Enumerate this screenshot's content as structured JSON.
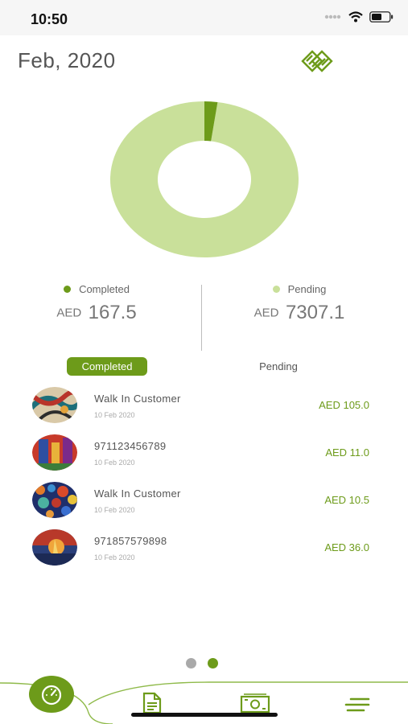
{
  "status_bar": {
    "time": "10:50"
  },
  "header": {
    "month": "Feb, 2020"
  },
  "donut": {
    "completed": 167.5,
    "pending": 7307.1,
    "completed_color": "#6d9b1a",
    "pending_color": "#c9e09a"
  },
  "summary": {
    "completed": {
      "label": "Completed",
      "currency": "AED",
      "amount": "167.5",
      "color": "#6d9b1a"
    },
    "pending": {
      "label": "Pending",
      "currency": "AED",
      "amount": "7307.1",
      "color": "#c9e09a"
    }
  },
  "tabs": {
    "completed": "Completed",
    "pending": "Pending",
    "active": "completed"
  },
  "transactions": [
    {
      "customer": "Walk In Customer",
      "date": "10 Feb 2020",
      "amount": "AED 105.0"
    },
    {
      "customer": "971123456789",
      "date": "10 Feb 2020",
      "amount": "AED 11.0"
    },
    {
      "customer": "Walk In Customer",
      "date": "10 Feb 2020",
      "amount": "AED 10.5"
    },
    {
      "customer": "971857579898",
      "date": "10 Feb 2020",
      "amount": "AED 36.0"
    }
  ],
  "pager": {
    "count": 2,
    "active": 1,
    "active_color": "#6d9b1a",
    "inactive_color": "#a9a9a9"
  },
  "bottom_nav": {
    "items": [
      {
        "icon": "speedometer-icon",
        "active": true
      },
      {
        "icon": "document-icon",
        "active": false
      },
      {
        "icon": "cash-icon",
        "active": false
      },
      {
        "icon": "menu-icon",
        "active": false
      }
    ],
    "accent": "#6d9b1a"
  }
}
